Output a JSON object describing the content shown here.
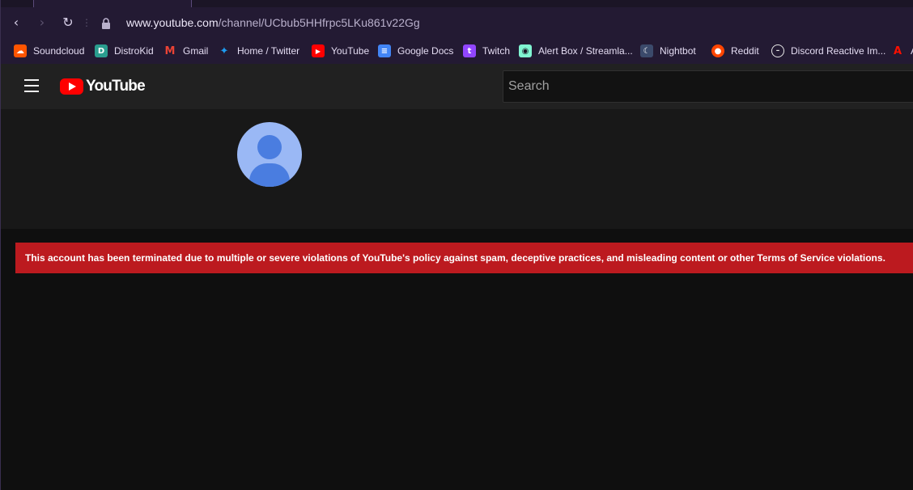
{
  "browser": {
    "url_host": "www.youtube.com",
    "url_path": "/channel/UCbub5HHfrpc5LKu861v22Gg",
    "nav": {
      "back_icon": "back-arrow-icon",
      "forward_icon": "forward-arrow-icon",
      "reload_icon": "reload-icon"
    }
  },
  "bookmarks": [
    {
      "label": "Soundcloud",
      "icon": "soundcloud-icon",
      "color": "#ff5500"
    },
    {
      "label": "DistroKid",
      "icon": "distrokid-icon",
      "color": "#2a9d8f"
    },
    {
      "label": "Gmail",
      "icon": "gmail-icon",
      "color": "#ea4335"
    },
    {
      "label": "Home / Twitter",
      "icon": "twitter-icon",
      "color": "#1d9bf0"
    },
    {
      "label": "YouTube",
      "icon": "youtube-icon",
      "color": "#ff0000"
    },
    {
      "label": "Google Docs",
      "icon": "google-docs-icon",
      "color": "#4285f4"
    },
    {
      "label": "Twitch",
      "icon": "twitch-icon",
      "color": "#9146ff"
    },
    {
      "label": "Alert Box / Streamla...",
      "icon": "streamlabs-icon",
      "color": "#80f5d2"
    },
    {
      "label": "Nightbot",
      "icon": "nightbot-icon",
      "color": "#3b4a6b"
    },
    {
      "label": "Reddit",
      "icon": "reddit-icon",
      "color": "#ff4500"
    },
    {
      "label": "Discord Reactive Im...",
      "icon": "discord-reactive-icon",
      "color": "#e8e8e8"
    },
    {
      "label": "A",
      "icon": "adobe-icon",
      "color": "#fa0f00"
    }
  ],
  "youtube": {
    "logo_text": "YouTube",
    "search_placeholder": "Search",
    "brand_color": "#ff0000"
  },
  "alert": {
    "message": "This account has been terminated due to multiple or severe violations of YouTube's policy against spam, deceptive practices, and misleading content or other Terms of Service violations.",
    "color": "#bc1a1f"
  }
}
